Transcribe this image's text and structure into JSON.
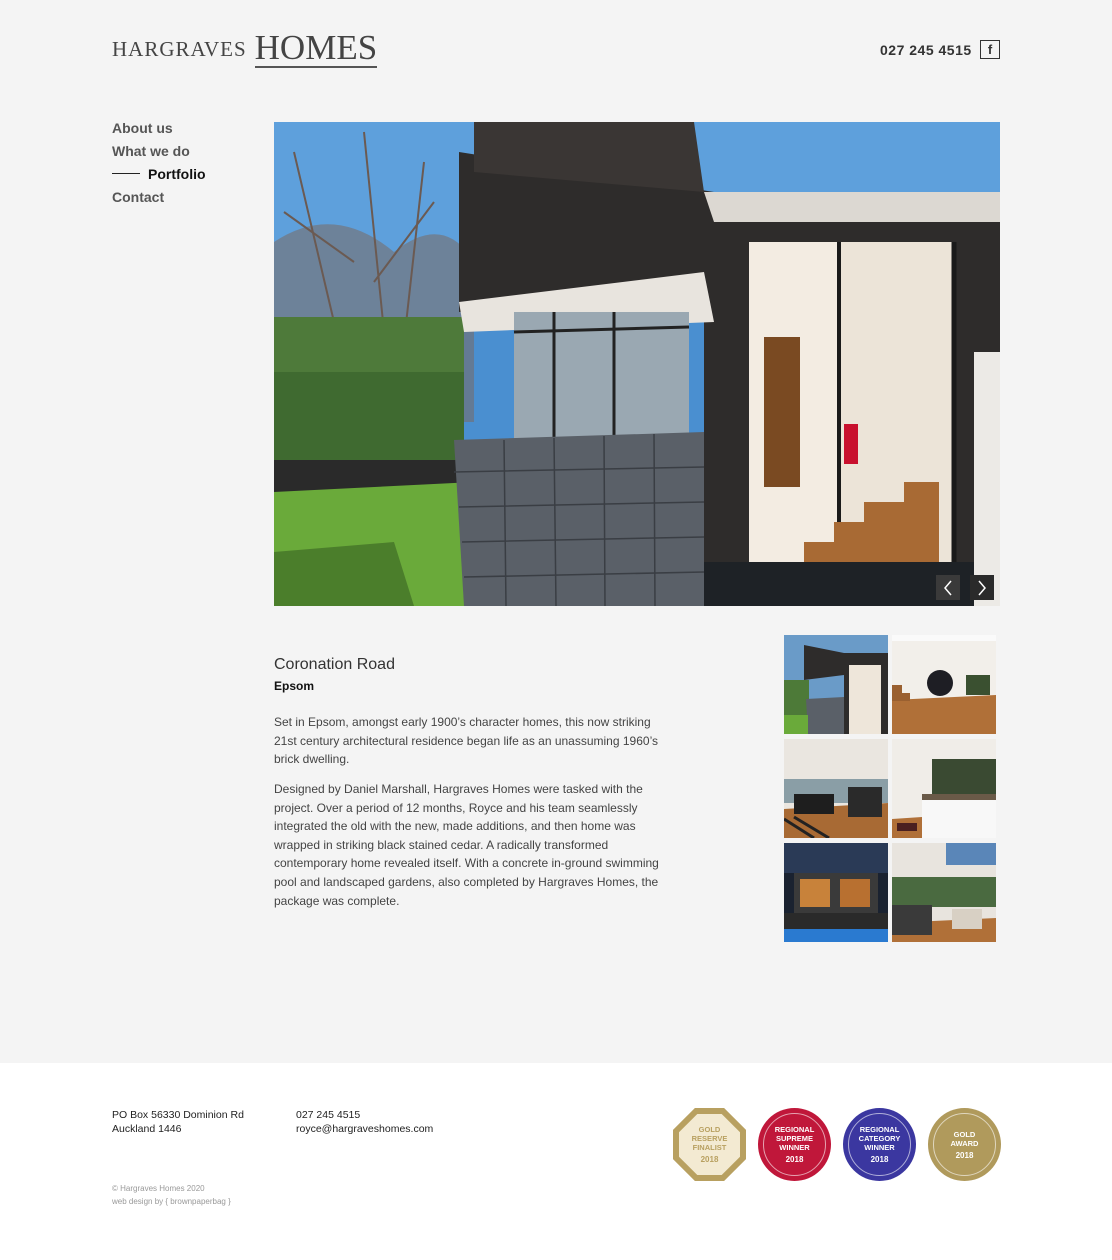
{
  "header": {
    "logo_small": "HARGRAVES",
    "logo_big": "HOMES",
    "phone": "027 245 4515",
    "facebook_glyph": "f"
  },
  "nav": {
    "items": [
      {
        "label": "About us"
      },
      {
        "label": "What we do"
      },
      {
        "label": "Portfolio",
        "active": true
      },
      {
        "label": "Contact"
      }
    ]
  },
  "gallery": {
    "prev_glyph": "‹",
    "next_glyph": "›"
  },
  "project": {
    "title": "Coronation Road",
    "suburb": "Epsom",
    "paragraphs": [
      "Set in Epsom, amongst early 1900’s character homes, this now striking 21st century architectural residence began life as an unassuming 1960’s brick dwelling.",
      "Designed by Daniel Marshall, Hargraves Homes were tasked with the project. Over a period of 12 months, Royce and his team seamlessly integrated the old with the new, made additions, and then home was wrapped in striking black stained cedar. A radically transformed contemporary home revealed itself. With a concrete in-ground swimming pool and landscaped gardens, also completed by Hargraves Homes, the package was complete."
    ]
  },
  "footer": {
    "address_line1": "PO Box 56330 Dominion Rd",
    "address_line2": "Auckland 1446",
    "phone": "027 245 4515",
    "email": "royce@hargraveshomes.com",
    "copyright": "© Hargraves Homes 2020",
    "credit": "web design by { brownpaperbag }",
    "badges": [
      {
        "line1": "GOLD",
        "line2": "RESERVE",
        "line3": "FINALIST",
        "year": "2018",
        "color": "#b8a060"
      },
      {
        "line1": "REGIONAL",
        "line2": "SUPREME",
        "line3": "WINNER",
        "year": "2018",
        "color": "#c0173a"
      },
      {
        "line1": "REGIONAL",
        "line2": "CATEGORY",
        "line3": "WINNER",
        "year": "2018",
        "color": "#3b37a0"
      },
      {
        "line1": "GOLD",
        "line2": "AWARD",
        "line3": "",
        "year": "2018",
        "color": "#b09a5c"
      }
    ]
  },
  "colors": {
    "background": "#f4f4f4",
    "footer_bg": "#ffffff",
    "text_dark": "#333333"
  }
}
